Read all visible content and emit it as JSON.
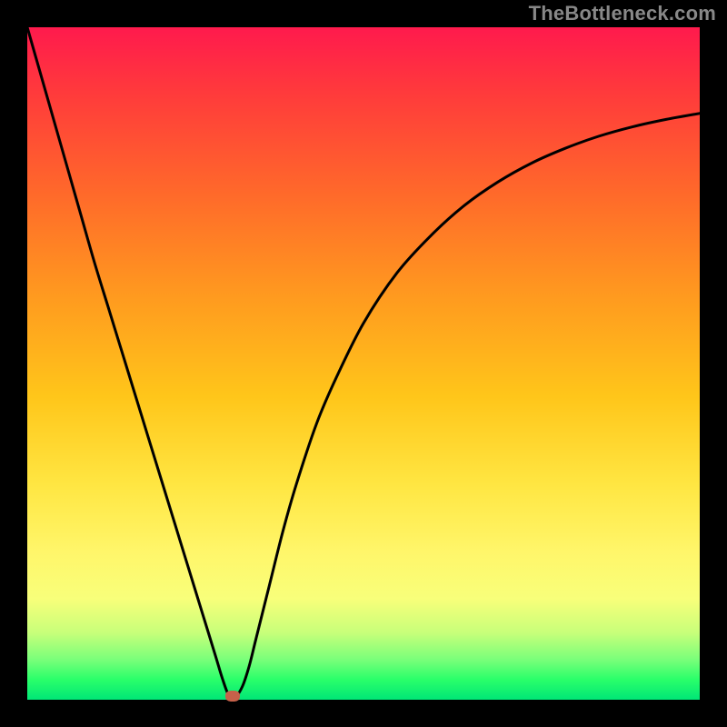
{
  "attribution": "TheBottleneck.com",
  "chart_data": {
    "type": "line",
    "title": "",
    "xlabel": "",
    "ylabel": "",
    "xlim": [
      0,
      100
    ],
    "ylim": [
      0,
      100
    ],
    "series": [
      {
        "name": "bottleneck-curve",
        "x": [
          0.0,
          2.0,
          4.0,
          6.0,
          8.0,
          10.0,
          12.0,
          14.0,
          16.0,
          18.0,
          20.0,
          22.0,
          24.0,
          26.0,
          28.0,
          29.0,
          30.0,
          31.0,
          32.0,
          33.0,
          34.0,
          36.0,
          38.0,
          40.0,
          43.0,
          46.0,
          50.0,
          55.0,
          60.0,
          65.0,
          70.0,
          75.0,
          80.0,
          85.0,
          90.0,
          95.0,
          100.0
        ],
        "y": [
          100.0,
          93.0,
          86.0,
          79.0,
          72.0,
          65.0,
          58.5,
          52.0,
          45.5,
          39.0,
          32.5,
          26.0,
          19.5,
          13.0,
          6.5,
          3.2,
          0.6,
          0.5,
          2.0,
          5.0,
          9.0,
          17.0,
          25.0,
          32.0,
          41.0,
          48.0,
          56.0,
          63.5,
          69.0,
          73.5,
          77.0,
          79.8,
          82.0,
          83.8,
          85.2,
          86.3,
          87.2
        ]
      }
    ],
    "marker": {
      "x": 30.5,
      "y": 0.5
    },
    "gradient_stops": [
      {
        "pct": 0,
        "color": "#ff1a4d"
      },
      {
        "pct": 10,
        "color": "#ff3b3b"
      },
      {
        "pct": 25,
        "color": "#ff6a2a"
      },
      {
        "pct": 40,
        "color": "#ff9a1f"
      },
      {
        "pct": 55,
        "color": "#ffc61a"
      },
      {
        "pct": 68,
        "color": "#ffe642"
      },
      {
        "pct": 78,
        "color": "#fff66a"
      },
      {
        "pct": 85,
        "color": "#f8ff7a"
      },
      {
        "pct": 90,
        "color": "#c8ff7a"
      },
      {
        "pct": 94,
        "color": "#7aff7a"
      },
      {
        "pct": 97,
        "color": "#2aff6a"
      },
      {
        "pct": 100,
        "color": "#00e676"
      }
    ]
  }
}
